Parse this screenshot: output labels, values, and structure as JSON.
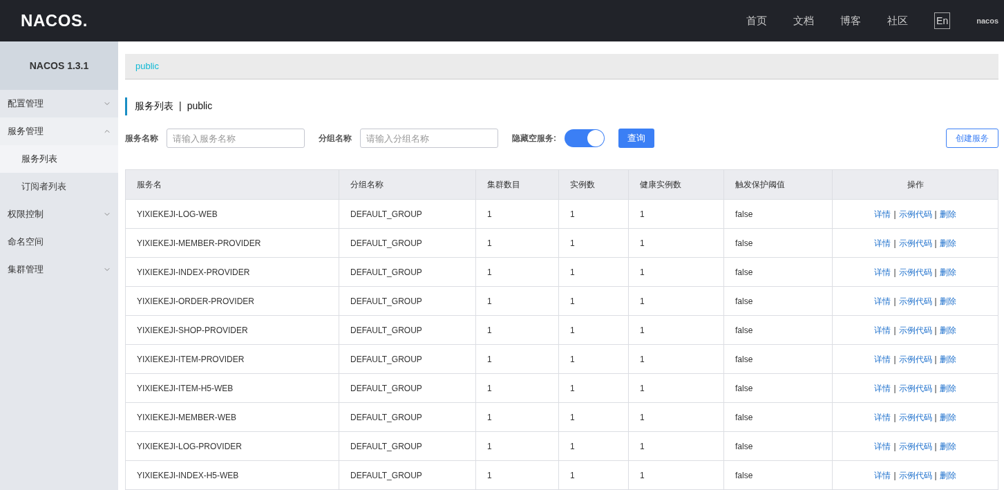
{
  "header": {
    "logo": "NACOS.",
    "nav": [
      "首页",
      "文档",
      "博客",
      "社区"
    ],
    "language": "En",
    "user": "nacos"
  },
  "sidebar": {
    "title": "NACOS 1.3.1",
    "items": [
      {
        "label": "配置管理",
        "expandable": true,
        "expanded": false
      },
      {
        "label": "服务管理",
        "expandable": true,
        "expanded": true,
        "children": [
          {
            "label": "服务列表",
            "selected": true
          },
          {
            "label": "订阅者列表",
            "selected": false
          }
        ]
      },
      {
        "label": "权限控制",
        "expandable": true,
        "expanded": false
      },
      {
        "label": "命名空间",
        "expandable": false
      },
      {
        "label": "集群管理",
        "expandable": true,
        "expanded": false
      }
    ]
  },
  "namespace_bar": {
    "namespaces": [
      "public"
    ]
  },
  "page_title": {
    "title": "服务列表",
    "separator": "|",
    "namespace": "public"
  },
  "filters": {
    "service_name": {
      "label": "服务名称",
      "placeholder": "请输入服务名称"
    },
    "group_name": {
      "label": "分组名称",
      "placeholder": "请输入分组名称"
    },
    "hide_empty": {
      "label": "隐藏空服务:",
      "on": true
    },
    "query_button": "查询",
    "create_button": "创建服务"
  },
  "table": {
    "columns": [
      "服务名",
      "分组名称",
      "集群数目",
      "实例数",
      "健康实例数",
      "触发保护阈值",
      "操作"
    ],
    "action_separator": "|",
    "rows": [
      {
        "cells": [
          "YIXIEKEJI-LOG-WEB",
          "DEFAULT_GROUP",
          "1",
          "1",
          "1",
          "false"
        ],
        "actions": [
          "详情",
          "示例代码",
          "删除"
        ]
      },
      {
        "cells": [
          "YIXIEKEJI-MEMBER-PROVIDER",
          "DEFAULT_GROUP",
          "1",
          "1",
          "1",
          "false"
        ],
        "actions": [
          "详情",
          "示例代码",
          "删除"
        ]
      },
      {
        "cells": [
          "YIXIEKEJI-INDEX-PROVIDER",
          "DEFAULT_GROUP",
          "1",
          "1",
          "1",
          "false"
        ],
        "actions": [
          "详情",
          "示例代码",
          "删除"
        ]
      },
      {
        "cells": [
          "YIXIEKEJI-ORDER-PROVIDER",
          "DEFAULT_GROUP",
          "1",
          "1",
          "1",
          "false"
        ],
        "actions": [
          "详情",
          "示例代码",
          "删除"
        ]
      },
      {
        "cells": [
          "YIXIEKEJI-SHOP-PROVIDER",
          "DEFAULT_GROUP",
          "1",
          "1",
          "1",
          "false"
        ],
        "actions": [
          "详情",
          "示例代码",
          "删除"
        ]
      },
      {
        "cells": [
          "YIXIEKEJI-ITEM-PROVIDER",
          "DEFAULT_GROUP",
          "1",
          "1",
          "1",
          "false"
        ],
        "actions": [
          "详情",
          "示例代码",
          "删除"
        ]
      },
      {
        "cells": [
          "YIXIEKEJI-ITEM-H5-WEB",
          "DEFAULT_GROUP",
          "1",
          "1",
          "1",
          "false"
        ],
        "actions": [
          "详情",
          "示例代码",
          "删除"
        ]
      },
      {
        "cells": [
          "YIXIEKEJI-MEMBER-WEB",
          "DEFAULT_GROUP",
          "1",
          "1",
          "1",
          "false"
        ],
        "actions": [
          "详情",
          "示例代码",
          "删除"
        ]
      },
      {
        "cells": [
          "YIXIEKEJI-LOG-PROVIDER",
          "DEFAULT_GROUP",
          "1",
          "1",
          "1",
          "false"
        ],
        "actions": [
          "详情",
          "示例代码",
          "删除"
        ]
      },
      {
        "cells": [
          "YIXIEKEJI-INDEX-H5-WEB",
          "DEFAULT_GROUP",
          "1",
          "1",
          "1",
          "false"
        ],
        "actions": [
          "详情",
          "示例代码",
          "删除"
        ]
      }
    ]
  }
}
